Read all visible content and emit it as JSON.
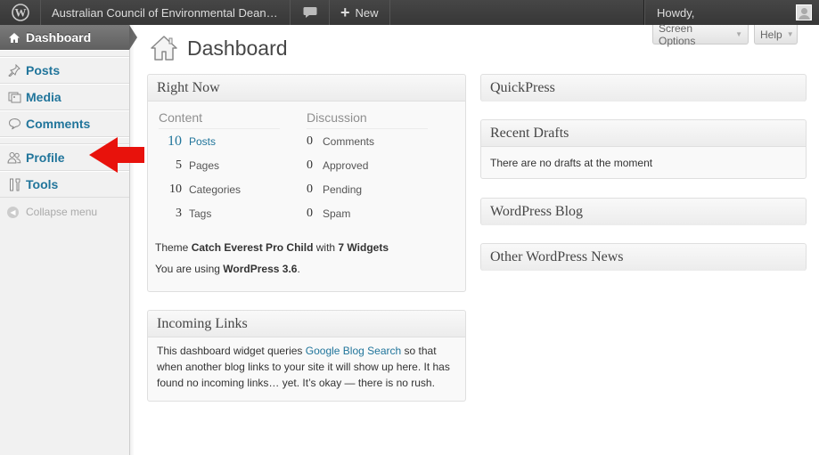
{
  "adminbar": {
    "site_name": "Australian Council of Environmental Dean…",
    "new_label": "New",
    "howdy": "Howdy,"
  },
  "sidebar": {
    "items": [
      {
        "label": "Dashboard",
        "icon": "home-icon"
      },
      {
        "label": "Posts",
        "icon": "pushpin-icon"
      },
      {
        "label": "Media",
        "icon": "media-icon"
      },
      {
        "label": "Comments",
        "icon": "comment-bubble-icon"
      },
      {
        "label": "Profile",
        "icon": "users-icon"
      },
      {
        "label": "Tools",
        "icon": "tools-icon"
      }
    ],
    "collapse_label": "Collapse menu"
  },
  "screen_meta": {
    "screen_options": "Screen Options",
    "help": "Help"
  },
  "page": {
    "title": "Dashboard"
  },
  "right_now": {
    "title": "Right Now",
    "content_heading": "Content",
    "discussion_heading": "Discussion",
    "content": [
      {
        "count": "10",
        "label": "Posts"
      },
      {
        "count": "5",
        "label": "Pages"
      },
      {
        "count": "10",
        "label": "Categories"
      },
      {
        "count": "3",
        "label": "Tags"
      }
    ],
    "discussion": [
      {
        "count": "0",
        "label": "Comments"
      },
      {
        "count": "0",
        "label": "Approved"
      },
      {
        "count": "0",
        "label": "Pending"
      },
      {
        "count": "0",
        "label": "Spam"
      }
    ],
    "theme_prefix": "Theme ",
    "theme_name": "Catch Everest Pro Child",
    "theme_with": " with ",
    "widgets": "7 Widgets",
    "version_prefix": "You are using ",
    "version": "WordPress 3.6",
    "version_suffix": "."
  },
  "incoming_links": {
    "title": "Incoming Links",
    "text_before": "This dashboard widget queries ",
    "link": "Google Blog Search",
    "text_after": " so that when another blog links to your site it will show up here. It has found no incoming links… yet. It’s okay — there is no rush."
  },
  "quickpress": {
    "title": "QuickPress"
  },
  "recent_drafts": {
    "title": "Recent Drafts",
    "text": "There are no drafts at the moment"
  },
  "wordpress_blog": {
    "title": "WordPress Blog"
  },
  "other_news": {
    "title": "Other WordPress News"
  }
}
